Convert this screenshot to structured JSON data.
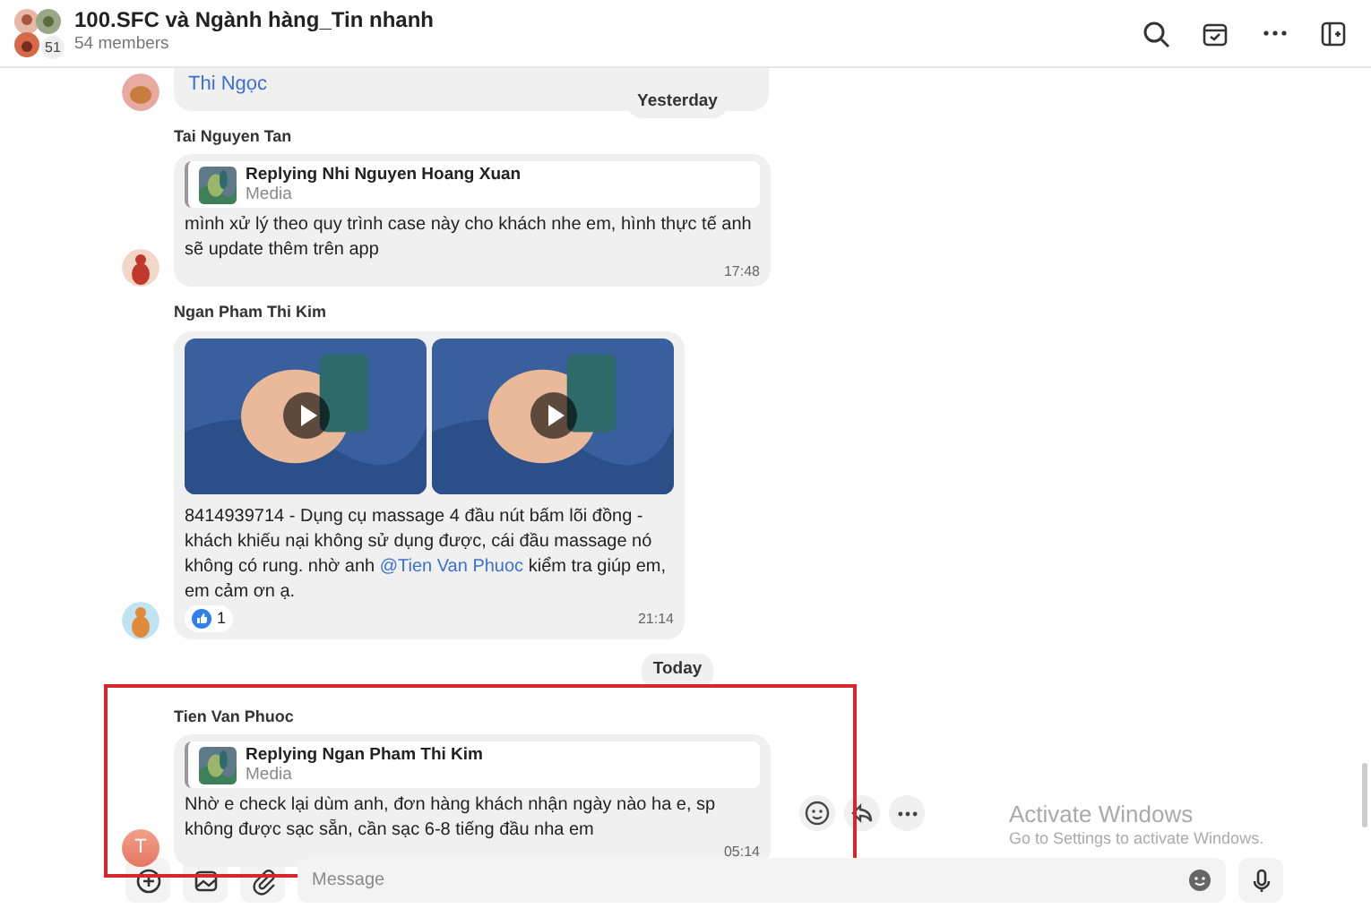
{
  "header": {
    "title": "100.SFC và Ngành hàng_Tin nhanh",
    "members": "54 members",
    "avatar_count": "51"
  },
  "messages": [
    {
      "kind": "fragment",
      "text": "Thi Ngọc"
    },
    {
      "kind": "date",
      "label": "Yesterday"
    },
    {
      "kind": "message",
      "sender": "Tai Nguyen Tan",
      "reply": {
        "title": "Replying Nhi Nguyen Hoang Xuan",
        "subtitle": "Media"
      },
      "text": "mình xử lý theo quy trình case này cho khách nhe em, hình thực tế anh sẽ update thêm trên app",
      "time": "17:48",
      "highlighted": false
    },
    {
      "kind": "message",
      "sender": "Ngan Pham Thi Kim",
      "text": "8414939714 - Dụng cụ massage 4 đầu nút bấm lõi đồng  - khách khiếu nại không sử dụng được, cái đầu massage nó không có rung. nhờ anh ",
      "mention": "@Tien Van Phuoc",
      "text_after": " kiểm tra giúp em, em cảm ơn ạ.",
      "reaction": {
        "count": "1"
      },
      "time": "21:14",
      "highlighted": false
    },
    {
      "kind": "date",
      "label": "Today"
    },
    {
      "kind": "message",
      "sender": "Tien Van Phuoc",
      "avatar_letter": "T",
      "reply": {
        "title": "Replying Ngan Pham Thi Kim",
        "subtitle": "Media"
      },
      "text": "Nhờ e check lại dùm anh, đơn hàng khách nhận ngày nào ha e, sp không được sạc sẵn, cần sạc 6-8 tiếng đầu nha em",
      "time": "05:14",
      "highlighted": true,
      "actions": true
    }
  ],
  "composer": {
    "placeholder": "Message"
  },
  "activation_notice": {
    "title": "Activate Windows",
    "text": "Go to Settings to activate Windows."
  }
}
